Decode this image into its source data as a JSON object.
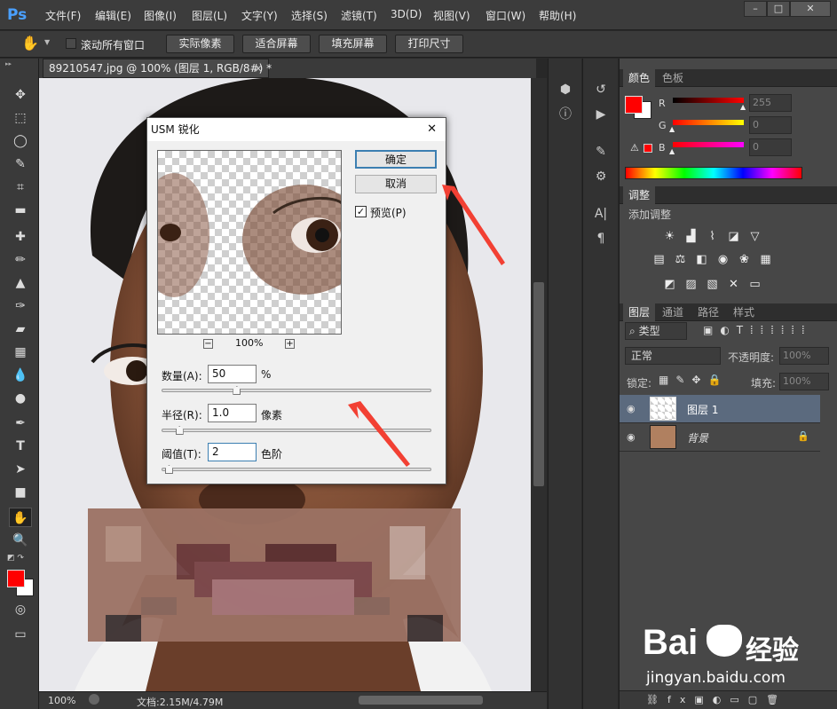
{
  "app": {
    "logo": "Ps",
    "brand_color": "#31a8ff"
  },
  "menubar": {
    "items": [
      "文件(F)",
      "编辑(E)",
      "图像(I)",
      "图层(L)",
      "文字(Y)",
      "选择(S)",
      "滤镜(T)",
      "3D(D)",
      "视图(V)",
      "窗口(W)",
      "帮助(H)"
    ],
    "window_controls": [
      "–",
      "□",
      "✕"
    ]
  },
  "options": {
    "scroll_all_label": "滚动所有窗口",
    "actual_pixels": "实际像素",
    "fit_screen": "适合屏幕",
    "fill_screen": "填充屏幕",
    "print_size": "打印尺寸"
  },
  "document": {
    "tab_title": "89210547.jpg @ 100% (图层 1, RGB/8#) *",
    "tab_close": "×",
    "zoom": "100%",
    "doc_info": "文档:2.15M/4.79M"
  },
  "dialog": {
    "title": "USM 锐化",
    "close": "✕",
    "ok": "确定",
    "cancel": "取消",
    "preview_label": "预览(P)",
    "preview_checked": true,
    "zoom_minus": "−",
    "zoom_level": "100%",
    "zoom_plus": "+",
    "amount_label": "数量(A):",
    "amount_value": "50",
    "amount_unit": "%",
    "amount_slider": 0.27,
    "radius_label": "半径(R):",
    "radius_value": "1.0",
    "radius_unit": "像素",
    "radius_slider": 0.05,
    "threshold_label": "阈值(T):",
    "threshold_value": "2",
    "threshold_unit": "色阶",
    "threshold_slider": 0.01
  },
  "color_panel": {
    "tabs": [
      "颜色",
      "色板"
    ],
    "channels": [
      {
        "label": "R",
        "value": "255"
      },
      {
        "label": "G",
        "value": "0"
      },
      {
        "label": "B",
        "value": "0"
      }
    ],
    "foreground": "#ff0000",
    "background": "#ffffff"
  },
  "adjust_panel": {
    "tab": "调整",
    "add_label": "添加调整"
  },
  "layers_panel": {
    "tabs": [
      "图层",
      "通道",
      "路径",
      "样式"
    ],
    "filter_label": "类型",
    "blend_mode": "正常",
    "opacity_label": "不透明度:",
    "opacity_value": "100%",
    "lock_label": "锁定:",
    "fill_label": "填充:",
    "fill_value": "100%",
    "layers": [
      {
        "name": "图层 1",
        "selected": true
      },
      {
        "name": "背景",
        "selected": false
      }
    ]
  },
  "watermark": {
    "brand_latin": "Bai",
    "brand_suffix": "经验",
    "url": "jingyan.baidu.com"
  }
}
